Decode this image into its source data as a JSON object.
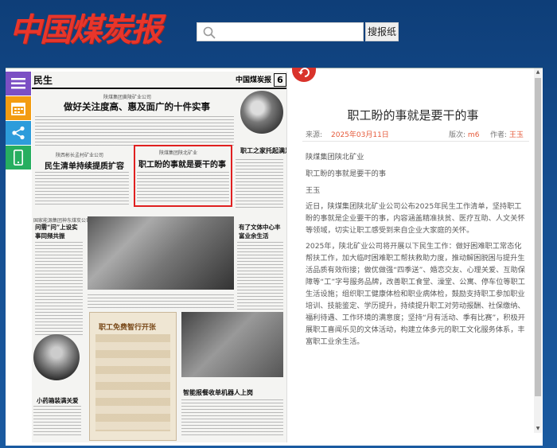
{
  "header": {
    "masthead": "中国煤炭报",
    "search_placeholder": "",
    "search_button": "搜报纸"
  },
  "side_tools": [
    "menu-icon",
    "calendar-icon",
    "share-icon",
    "mobile-icon"
  ],
  "paper": {
    "section": "民生",
    "brand": "中国煤炭报",
    "page_number": "6",
    "stories": [
      {
        "kicker": "陕煤集团黄陵矿业公司",
        "headline": "做好关注度高、惠及面广的十件实事"
      },
      {
        "kicker": "陕西彬长孟村矿业公司",
        "headline": "民生清单持续提质扩容"
      },
      {
        "kicker": "陕煤集团陕北矿业",
        "headline": "职工盼的事就是要干的事"
      },
      {
        "kicker": "",
        "headline": "职工之家托起满足不同需求"
      },
      {
        "kicker": "国家能源集团神东煤炭公司",
        "headline": "问需“问”上设实事同频共振"
      },
      {
        "kicker": "",
        "headline": "有了文体中心丰富业余生活"
      },
      {
        "kicker": "",
        "headline": "职工免费智行开张"
      },
      {
        "kicker": "",
        "headline": "小药箱装满关爱"
      },
      {
        "kicker": "",
        "headline": "智能报餐收单机器人上岗"
      }
    ]
  },
  "article": {
    "title": "职工盼的事就是要干的事",
    "source_label": "来源:",
    "date": "2025年03月11日",
    "edition_label": "版次:",
    "edition": "m6",
    "author_label": "作者:",
    "author": "王玉",
    "lines": [
      "陕煤集团陕北矿业",
      "职工盼的事就是要干的事",
      "王玉"
    ],
    "paragraphs": [
      "近日，陕煤集团陕北矿业公司公布2025年民生工作清单，坚持职工盼的事就是企业要干的事，内容涵盖精准扶贫、医疗互助、人文关怀等领域，切实让职工感受到来自企业大家庭的关怀。",
      "2025年，陕北矿业公司将开展以下民生工作：做好困难职工常态化帮扶工作，加大临时困难职工帮扶救助力度，推动解困脱困与提升生活品质有效衔接；做优做强“四季送”、婚恋交友、心理关爱、互助保障等“工”字号服务品牌，改善职工食堂、澡堂、公寓、停车位等职工生活设施；组织职工健康体检和职业病体检，鼓励支持职工参加职业培训、技能鉴定、学历提升，持续提升职工对劳动报酬、社保缴纳、福利待遇、工作环境的满意度；坚持“月有活动、季有比赛”，积极开展职工喜闻乐见的文体活动，构建立体多元的职工文化服务体系，丰富职工业余生活。"
    ]
  },
  "colors": {
    "masthead": "#e8362b",
    "highlight_border": "#e02020",
    "accent_text": "#e65a3a",
    "background": "#154d8f"
  }
}
